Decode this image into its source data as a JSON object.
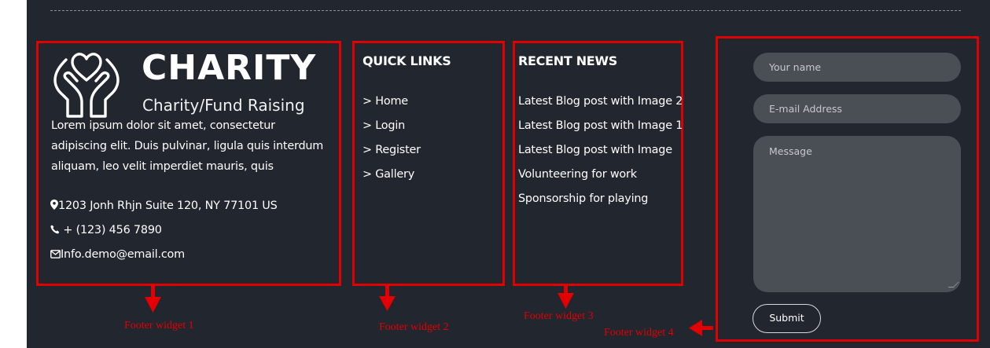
{
  "colors": {
    "background": "#22262f",
    "annotation_red": "#e10000",
    "input_fill": "#4a4e55"
  },
  "widget1": {
    "logo_icon": "heart-in-hands-icon",
    "title": "CHARITY",
    "subtitle": "Charity/Fund Raising",
    "description_lines": [
      "Lorem ipsum dolor sit amet, consectetur",
      "adipiscing elit. Duis pulvinar, ligula quis interdum",
      "aliquam, leo velit imperdiet mauris, quis"
    ],
    "address": "1203 Jonh Rhjn Suite 120, NY 77101 US",
    "phone": "+ (123) 456 7890",
    "email": "Info.demo@email.com"
  },
  "widget2": {
    "heading": "QUICK LINKS",
    "links": [
      "Home",
      "Login",
      "Register",
      "Gallery"
    ],
    "link_prefix": ">"
  },
  "widget3": {
    "heading": "RECENT NEWS",
    "items": [
      "Latest Blog post with Image 2",
      "Latest Blog post with Image 1",
      "Latest Blog post with Image",
      "Volunteering for work",
      "Sponsorship for playing"
    ]
  },
  "widget4": {
    "name_placeholder": "Your name",
    "email_placeholder": "E-mail Address",
    "message_placeholder": "Message",
    "submit_label": "Submit"
  },
  "annotations": [
    "Footer widget 1",
    "Footer widget 2",
    "Footer widget 3",
    "Footer widget 4"
  ]
}
